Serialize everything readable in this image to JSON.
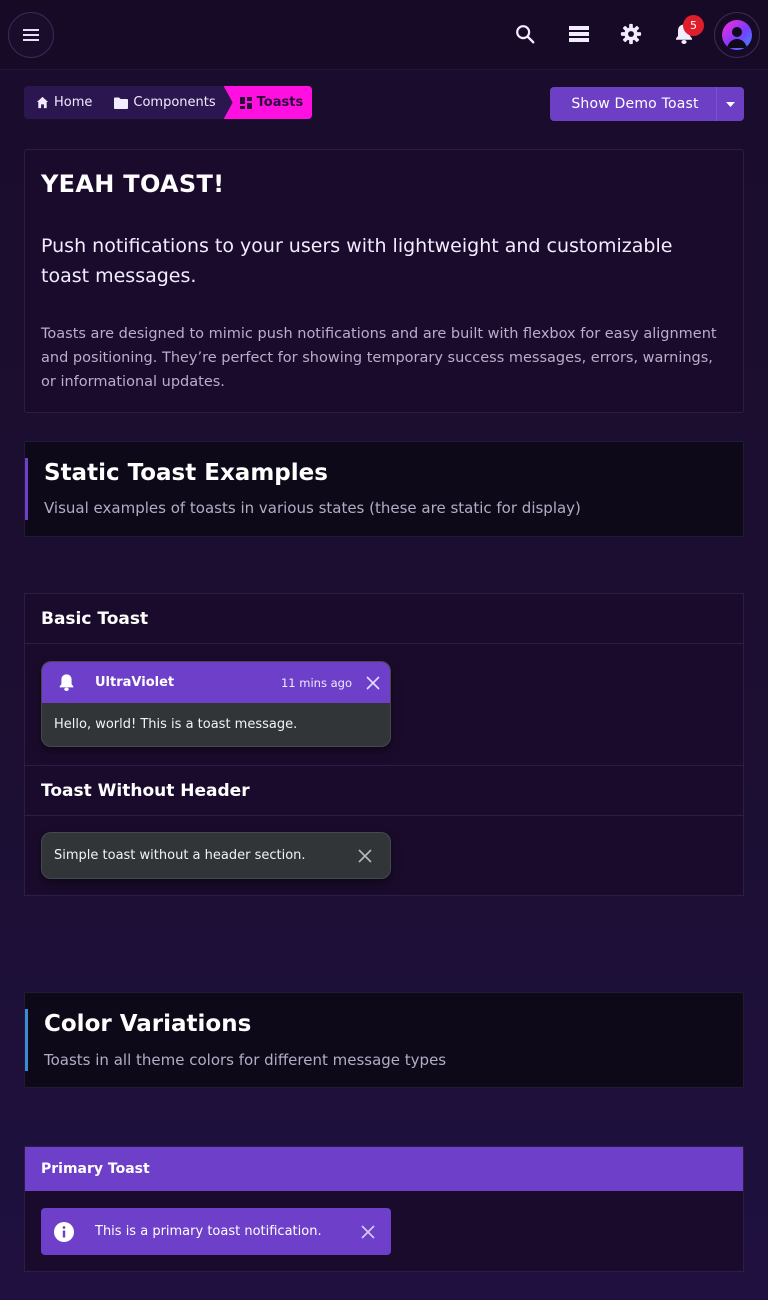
{
  "topbar": {
    "notification_count": "5",
    "icons": [
      "menu-icon",
      "search-icon",
      "stack-icon",
      "gear-icon",
      "bell-icon",
      "avatar"
    ]
  },
  "breadcrumb": {
    "items": [
      {
        "label": "Home",
        "icon": "home-icon"
      },
      {
        "label": "Components",
        "icon": "folder-icon"
      },
      {
        "label": "Toasts",
        "icon": "grid-icon"
      }
    ]
  },
  "demo_button": {
    "label": "Show Demo Toast"
  },
  "hero": {
    "title": "YEAH TOAST!",
    "lead": "Push notifications to your users with lightweight and customizable toast messages.",
    "description": "Toasts are designed to mimic push notifications and are built with flexbox for easy alignment and positioning. They’re perfect for showing temporary success messages, errors, warnings, or informational updates."
  },
  "static_section": {
    "title": "Static Toast Examples",
    "subtitle": "Visual examples of toasts in various states (these are static for display)",
    "accent": "#6e40c9"
  },
  "basic_card": {
    "title": "Basic Toast",
    "toast": {
      "app": "UltraViolet",
      "time": "11 mins ago",
      "message": "Hello, world! This is a toast message."
    }
  },
  "no_header_card": {
    "title": "Toast Without Header",
    "toast": {
      "message": "Simple toast without a header section."
    }
  },
  "color_section": {
    "title": "Color Variations",
    "subtitle": "Toasts in all theme colors for different message types",
    "accent": "#3a8cd9"
  },
  "primary_card": {
    "title": "Primary Toast",
    "toast": {
      "message": "This is a primary toast notification."
    }
  },
  "colors": {
    "primary": "#6e40c9",
    "accent_pink": "#ff10e0",
    "badge": "#e01e2b"
  }
}
